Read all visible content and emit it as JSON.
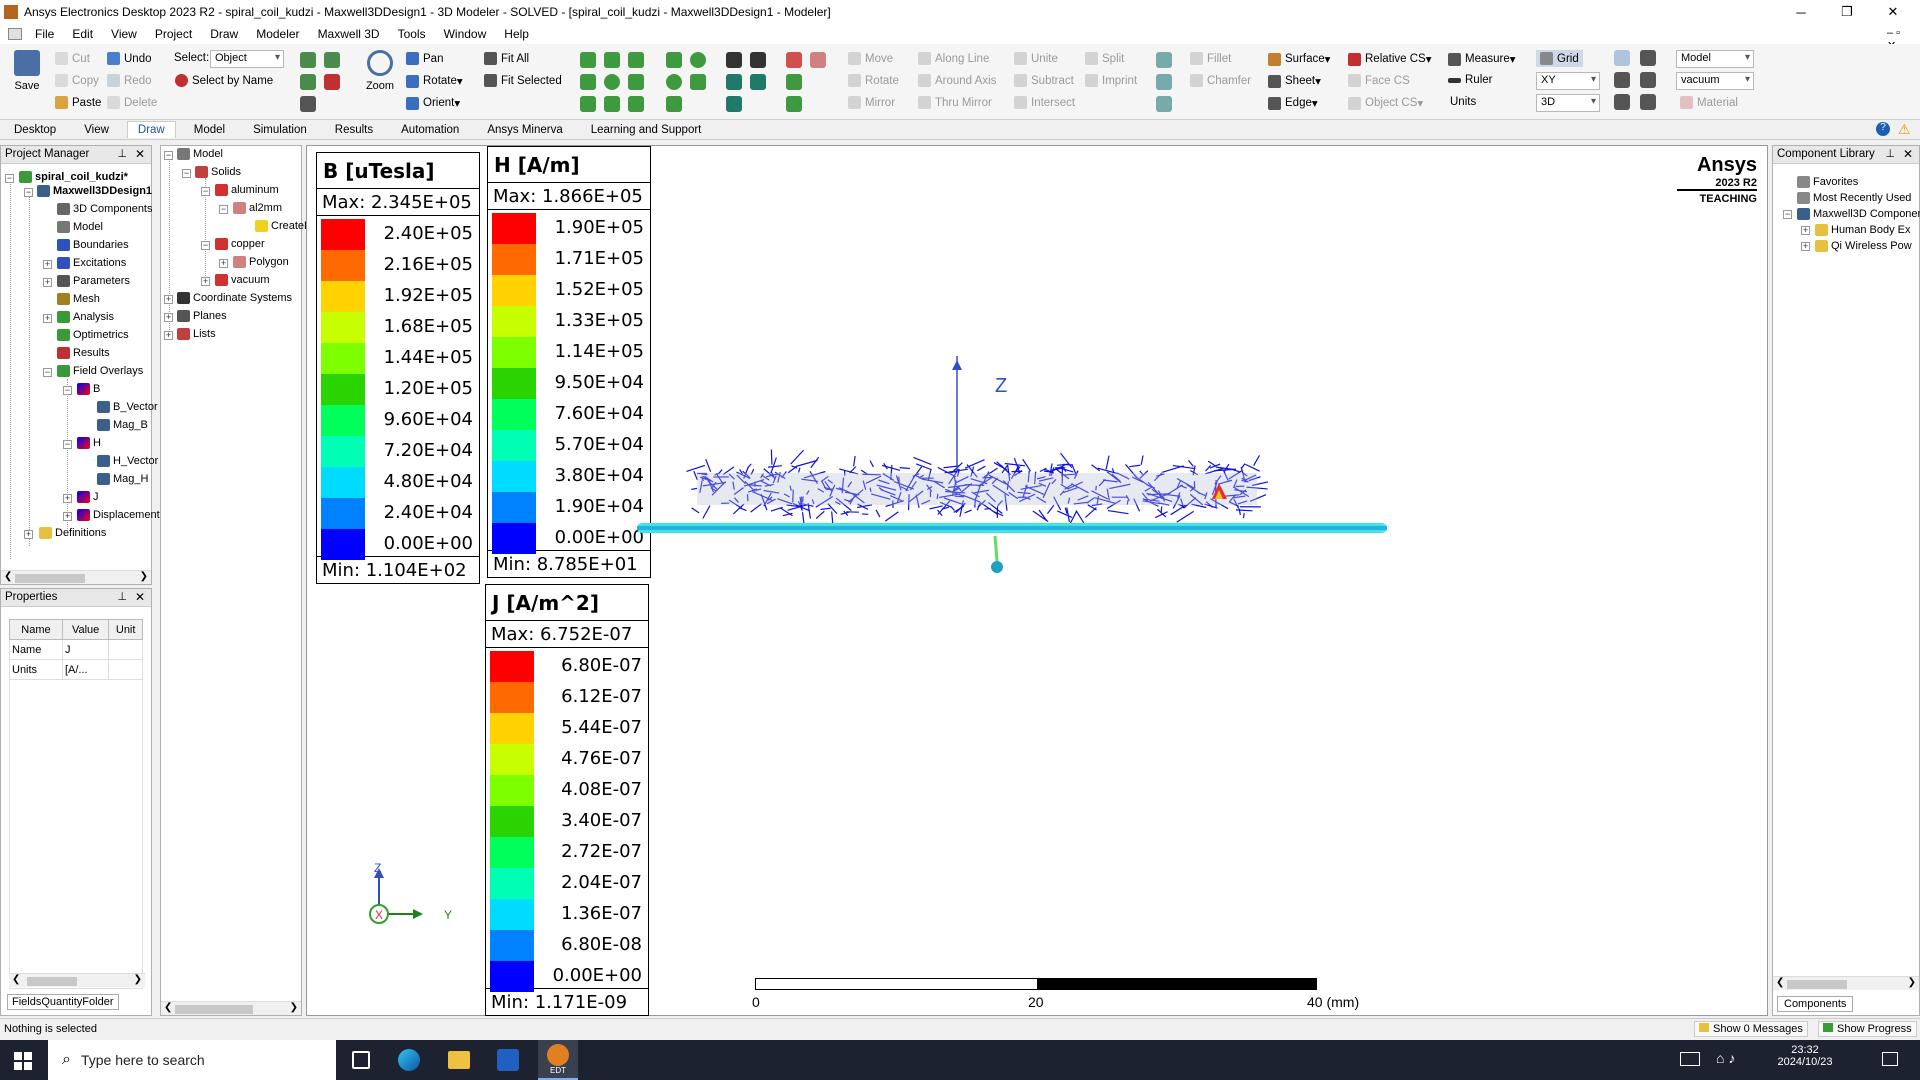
{
  "window": {
    "title": "Ansys Electronics Desktop 2023 R2 - spiral_coil_kudzi - Maxwell3DDesign1 - 3D Modeler - SOLVED - [spiral_coil_kudzi - Maxwell3DDesign1 - Modeler]"
  },
  "menu": [
    "File",
    "Edit",
    "View",
    "Project",
    "Draw",
    "Modeler",
    "Maxwell 3D",
    "Tools",
    "Window",
    "Help"
  ],
  "ribbon": {
    "save": "Save",
    "cut": "Cut",
    "copy": "Copy",
    "paste": "Paste",
    "undo": "Undo",
    "redo": "Redo",
    "delete": "Delete",
    "select_label": "Select:",
    "select_value": "Object",
    "select_by_name": "Select by Name",
    "pan": "Pan",
    "rotate": "Rotate",
    "orient": "Orient",
    "zoom": "Zoom",
    "fit_all": "Fit All",
    "fit_selected": "Fit Selected",
    "move": "Move",
    "rotate2": "Rotate",
    "mirror": "Mirror",
    "along_line": "Along Line",
    "around_axis": "Around Axis",
    "thru_mirror": "Thru Mirror",
    "unite": "Unite",
    "subtract": "Subtract",
    "intersect": "Intersect",
    "split": "Split",
    "imprint": "Imprint",
    "fillet": "Fillet",
    "chamfer": "Chamfer",
    "surface": "Surface",
    "sheet": "Sheet",
    "edge": "Edge",
    "relative_cs": "Relative CS",
    "face_cs": "Face CS",
    "object_cs": "Object CS",
    "measure": "Measure",
    "ruler": "Ruler",
    "units": "Units",
    "grid": "Grid",
    "grid_plane": "XY",
    "grid_dim": "3D",
    "model_combo": "Model",
    "material_combo": "vacuum",
    "material": "Material"
  },
  "tabs": [
    "Desktop",
    "View",
    "Draw",
    "Model",
    "Simulation",
    "Results",
    "Automation",
    "Ansys Minerva",
    "Learning and Support"
  ],
  "active_tab": "Draw",
  "project_manager": {
    "title": "Project Manager",
    "items": [
      "spiral_coil_kudzi*",
      "Maxwell3DDesign1",
      "3D Components",
      "Model",
      "Boundaries",
      "Excitations",
      "Parameters",
      "Mesh",
      "Analysis",
      "Optimetrics",
      "Results",
      "Field Overlays",
      "B",
      "B_Vector",
      "Mag_B",
      "H",
      "H_Vector",
      "Mag_H",
      "J",
      "Displacement",
      "Definitions"
    ]
  },
  "model_tree": {
    "items": [
      "Model",
      "Solids",
      "aluminum",
      "al2mm",
      "CreateBox",
      "copper",
      "Polygon",
      "vacuum",
      "Coordinate Systems",
      "Planes",
      "Lists"
    ]
  },
  "properties": {
    "title": "Properties",
    "headers": [
      "Name",
      "Value",
      "Unit"
    ],
    "rows": [
      [
        "Name",
        "J",
        ""
      ],
      [
        "Units",
        "[A/...",
        ""
      ]
    ],
    "tab": "FieldsQuantityFolder"
  },
  "component_library": {
    "title": "Component Library",
    "items": [
      "Favorites",
      "Most Recently Used",
      "Maxwell3D Components",
      "Human Body Ex",
      "Qi Wireless Pow"
    ],
    "tab": "Components"
  },
  "brand": {
    "name": "Ansys",
    "version": "2023 R2",
    "edition": "TEACHING"
  },
  "legend_colors": [
    "#ff0000",
    "#ff6a00",
    "#ffd200",
    "#c8ff00",
    "#7dff00",
    "#2ad400",
    "#00ff5a",
    "#00ffb4",
    "#00dcff",
    "#0082ff",
    "#0000ff"
  ],
  "legends": [
    {
      "title": "B [uTesla]",
      "max": "Max:  2.345E+05",
      "min": "Min:  1.104E+02",
      "ticks": [
        "2.40E+05",
        "2.16E+05",
        "1.92E+05",
        "1.68E+05",
        "1.44E+05",
        "1.20E+05",
        "9.60E+04",
        "7.20E+04",
        "4.80E+04",
        "2.40E+04",
        "0.00E+00"
      ]
    },
    {
      "title": "H [A/m]",
      "max": "Max:  1.866E+05",
      "min": "Min:  8.785E+01",
      "ticks": [
        "1.90E+05",
        "1.71E+05",
        "1.52E+05",
        "1.33E+05",
        "1.14E+05",
        "9.50E+04",
        "7.60E+04",
        "5.70E+04",
        "3.80E+04",
        "1.90E+04",
        "0.00E+00"
      ]
    },
    {
      "title": "J [A/m^2]",
      "max": "Max:  6.752E-07",
      "min": "Min:  1.171E-09",
      "ticks": [
        "6.80E-07",
        "6.12E-07",
        "5.44E-07",
        "4.76E-07",
        "4.08E-07",
        "3.40E-07",
        "2.72E-07",
        "2.04E-07",
        "1.36E-07",
        "6.80E-08",
        "0.00E+00"
      ]
    }
  ],
  "axes": {
    "z": "Z",
    "x": "X",
    "y": "Y"
  },
  "scale": {
    "labels": [
      "0",
      "20",
      "40 (mm)"
    ]
  },
  "status": {
    "left": "Nothing is selected",
    "messages": "Show 0 Messages",
    "progress": "Show Progress"
  },
  "taskbar": {
    "search": "Type here to search",
    "time": "23:32",
    "date": "2024/10/23",
    "app": "EDT"
  }
}
